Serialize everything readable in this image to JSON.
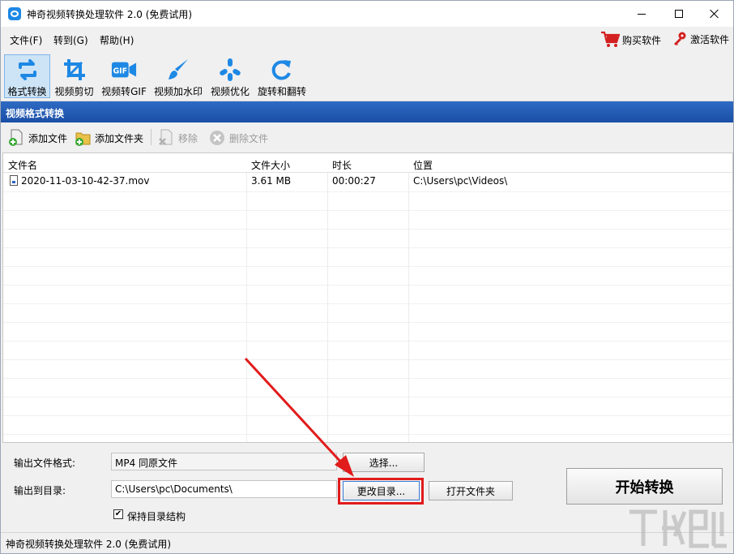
{
  "window": {
    "title": "神奇视频转换处理软件 2.0 (免费试用)"
  },
  "menu": {
    "file": "文件(F)",
    "goto": "转到(G)",
    "help": "帮助(H)",
    "buy": "购买软件",
    "activate": "激活软件"
  },
  "toolbar": {
    "items": [
      {
        "label": "格式转换",
        "icon": "format-convert-icon"
      },
      {
        "label": "视频剪切",
        "icon": "crop-icon"
      },
      {
        "label": "视频转GIF",
        "icon": "gif-icon"
      },
      {
        "label": "视频加水印",
        "icon": "brush-icon"
      },
      {
        "label": "视频优化",
        "icon": "optimize-icon"
      },
      {
        "label": "旋转和翻转",
        "icon": "rotate-icon"
      }
    ]
  },
  "section": {
    "title": "视频格式转换"
  },
  "subtoolbar": {
    "add_file": "添加文件",
    "add_folder": "添加文件夹",
    "remove": "移除",
    "delete_file": "删除文件"
  },
  "table": {
    "headers": [
      "文件名",
      "文件大小",
      "时长",
      "位置"
    ],
    "rows": [
      {
        "name": "2020-11-03-10-42-37.mov",
        "size": "3.61 MB",
        "duration": "00:00:27",
        "location": "C:\\Users\\pc\\Videos\\"
      }
    ]
  },
  "output": {
    "format_label": "输出文件格式:",
    "format_value": "MP4 同原文件",
    "select_button": "选择...",
    "dir_label": "输出到目录:",
    "dir_value": "C:\\Users\\pc\\Documents\\",
    "change_dir_button": "更改目录...",
    "open_folder_button": "打开文件夹",
    "keep_structure_label": "保持目录结构",
    "keep_structure_checked": true,
    "start_button": "开始转换"
  },
  "status": {
    "text": "神奇视频转换处理软件 2.0 (免费试用)"
  },
  "colors": {
    "section_header": "#1f58b0",
    "accent_icon": "#1e88e5",
    "annotation": "#e11b1b"
  }
}
